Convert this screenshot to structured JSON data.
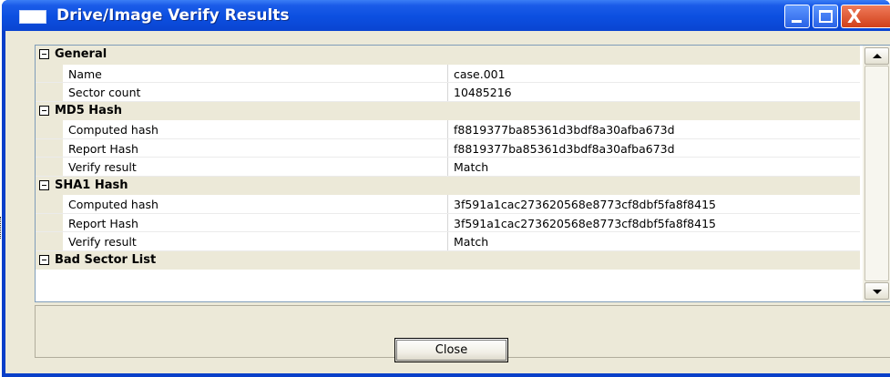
{
  "window": {
    "title": "Drive/Image Verify Results",
    "icons": {
      "app": "window-icon",
      "minimize": "minimize-icon",
      "maximize": "maximize-icon",
      "close": "close-icon"
    },
    "close_glyph": "X"
  },
  "grid": {
    "categories": [
      {
        "label": "General",
        "toggle": "⊟",
        "rows": [
          {
            "name": "Name",
            "value": "case.001"
          },
          {
            "name": "Sector count",
            "value": "10485216"
          }
        ]
      },
      {
        "label": "MD5 Hash",
        "toggle": "⊟",
        "rows": [
          {
            "name": "Computed hash",
            "value": "f8819377ba85361d3bdf8a30afba673d"
          },
          {
            "name": "Report Hash",
            "value": "f8819377ba85361d3bdf8a30afba673d"
          },
          {
            "name": "Verify result",
            "value": "Match"
          }
        ]
      },
      {
        "label": "SHA1 Hash",
        "toggle": "⊟",
        "rows": [
          {
            "name": "Computed hash",
            "value": "3f591a1cac273620568e8773cf8dbf5fa8f8415"
          },
          {
            "name": "Report Hash",
            "value": "3f591a1cac273620568e8773cf8dbf5fa8f8415"
          },
          {
            "name": "Verify result",
            "value": "Match"
          }
        ]
      },
      {
        "label": "Bad Sector List",
        "toggle": "⊟",
        "rows": []
      }
    ]
  },
  "footer": {
    "close_label": "Close"
  },
  "colors": {
    "titlebar": "#0a44d1",
    "face": "#ece9d8",
    "grid_border": "#7f9db9"
  }
}
